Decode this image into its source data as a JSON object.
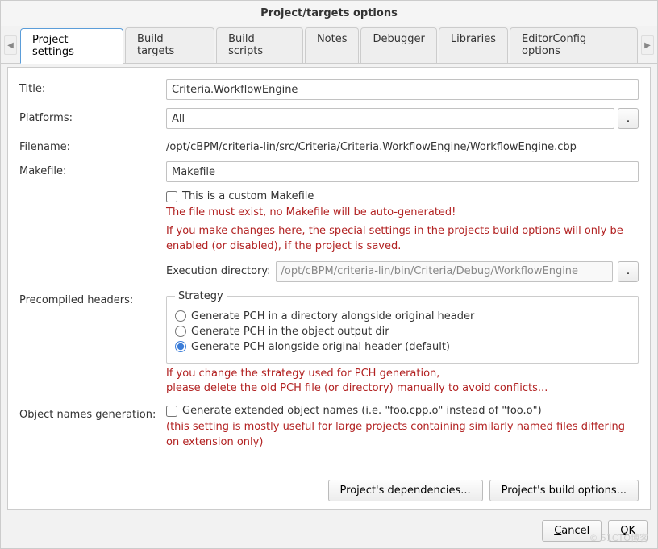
{
  "window": {
    "title": "Project/targets options"
  },
  "tabs": {
    "items": [
      "Project settings",
      "Build targets",
      "Build scripts",
      "Notes",
      "Debugger",
      "Libraries",
      "EditorConfig options"
    ]
  },
  "form": {
    "title_label": "Title:",
    "title_value": "Criteria.WorkflowEngine",
    "platforms_label": "Platforms:",
    "platforms_value": "All",
    "filename_label": "Filename:",
    "filename_value": "/opt/cBPM/criteria-lin/src/Criteria/Criteria.WorkflowEngine/WorkflowEngine.cbp",
    "makefile_label": "Makefile:",
    "makefile_value": "Makefile",
    "custom_makefile_checked": false,
    "custom_makefile_label": "This is a custom Makefile",
    "makefile_warn1": "The file must exist, no Makefile will be auto-generated!",
    "makefile_warn2": "If you make changes here, the special settings in the projects build options will only be enabled (or disabled), if the project is saved.",
    "exec_dir_label": "Execution directory:",
    "exec_dir_value": "/opt/cBPM/criteria-lin/bin/Criteria/Debug/WorkflowEngine",
    "pch_label": "Precompiled headers:",
    "strategy_legend": "Strategy",
    "strategy_options": [
      "Generate PCH in a directory alongside original header",
      "Generate PCH in the object output dir",
      "Generate PCH alongside original header (default)"
    ],
    "strategy_selected_index": 2,
    "pch_warn": "If you change the strategy used for PCH generation,\nplease delete the old PCH file (or directory) manually to avoid conflicts...",
    "objnames_label": "Object names generation:",
    "objnames_checked": false,
    "objnames_checkbox_label": "Generate extended object names (i.e. \"foo.cpp.o\" instead of \"foo.o\")",
    "objnames_warn": "(this setting is mostly useful for large projects containing similarly named files differing on extension only)"
  },
  "buttons": {
    "dependencies": "Project's dependencies...",
    "build_options": "Project's build options...",
    "cancel": "Cancel",
    "ok": "OK"
  },
  "watermark": "© 51CTO博客"
}
